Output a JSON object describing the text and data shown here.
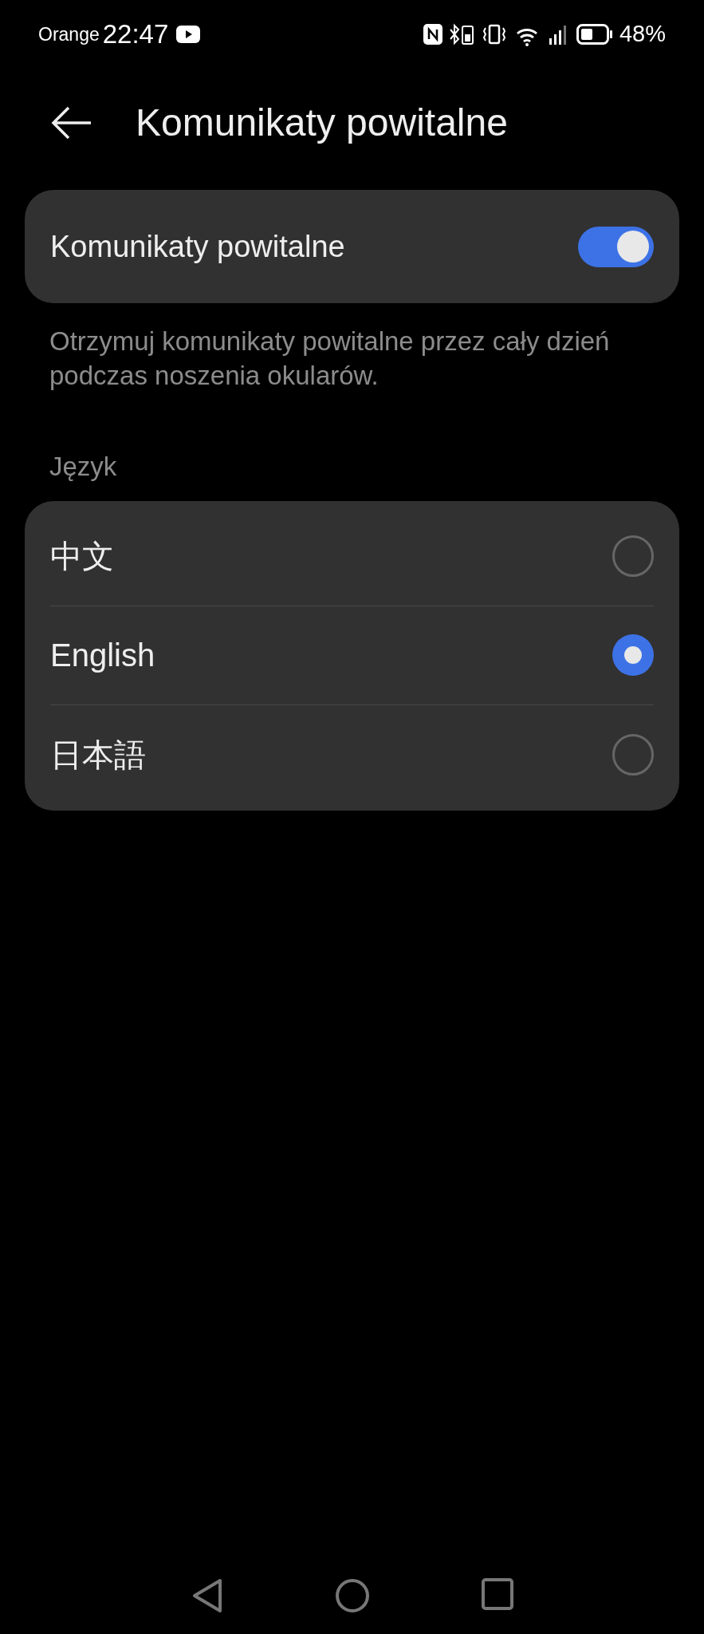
{
  "status_bar": {
    "carrier": "Orange",
    "time": "22:47",
    "battery": "48%"
  },
  "header": {
    "title": "Komunikaty powitalne"
  },
  "toggle_card": {
    "label": "Komunikaty powitalne",
    "on": true
  },
  "description": "Otrzymuj komunikaty powitalne przez cały dzień podczas noszenia okularów.",
  "language_section": {
    "title": "Język",
    "options": [
      {
        "label": "中文",
        "selected": false
      },
      {
        "label": "English",
        "selected": true
      },
      {
        "label": "日本語",
        "selected": false
      }
    ]
  }
}
